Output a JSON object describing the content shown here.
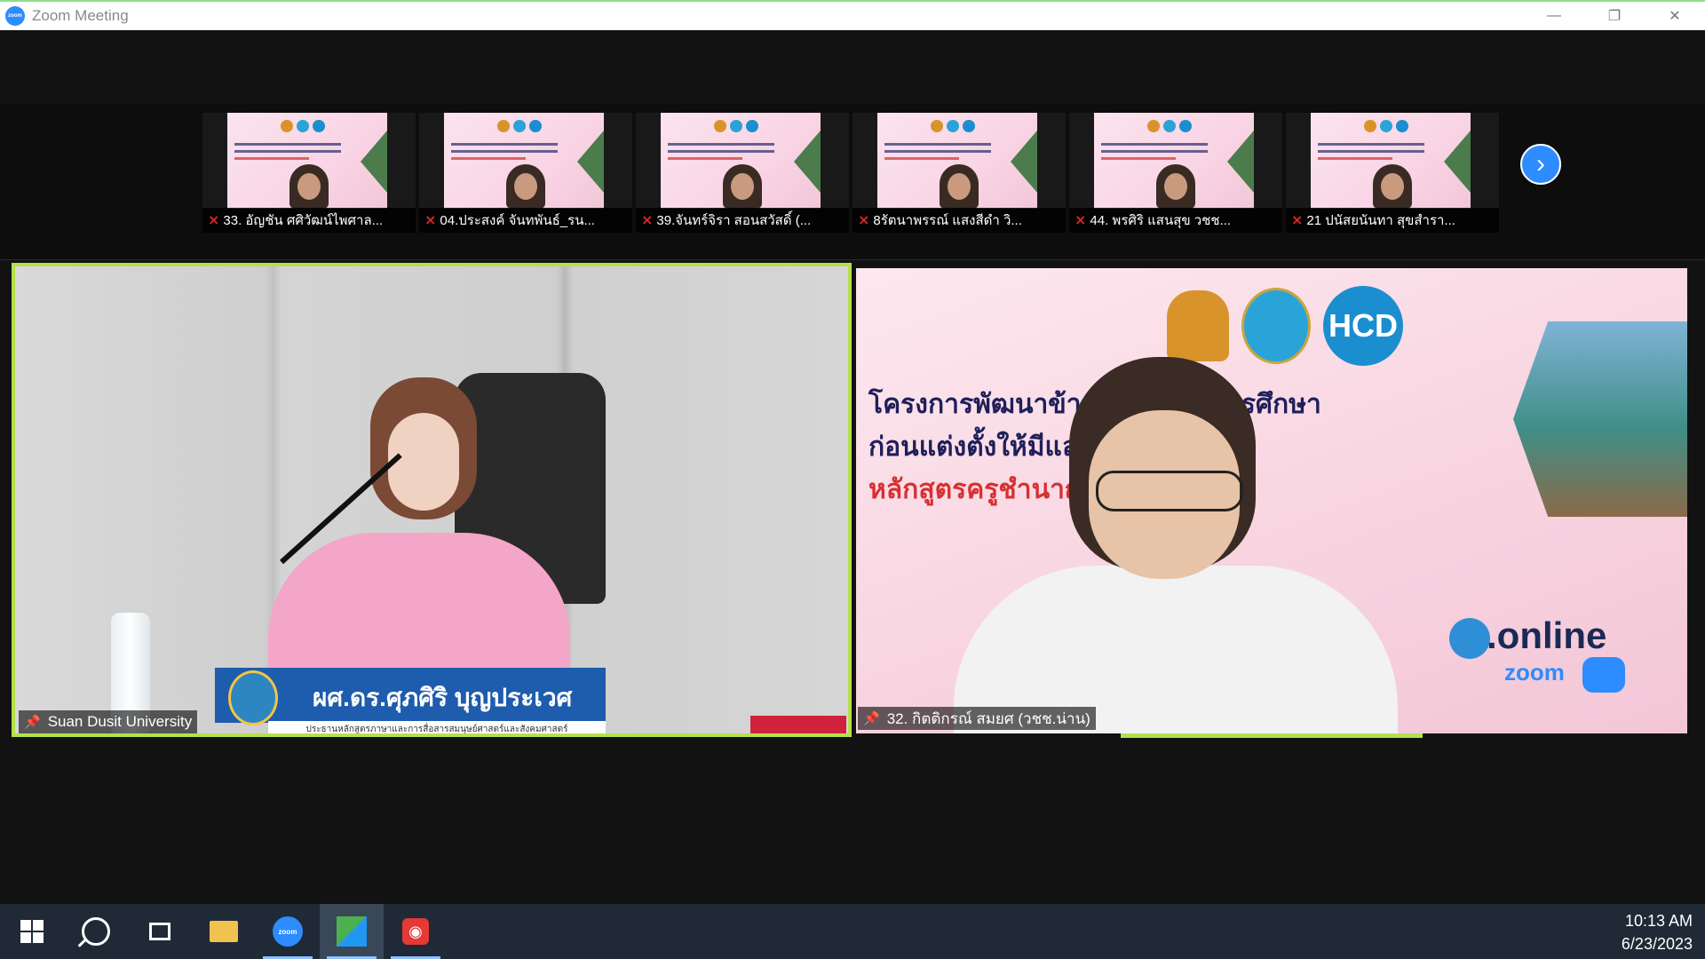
{
  "window": {
    "title": "Zoom Meeting",
    "minimize": "—",
    "maximize": "❐",
    "close": "✕"
  },
  "thumbnails": [
    {
      "name": "33. อัญชัน ศศิวัฒน์ไพศาล..."
    },
    {
      "name": "04.ประสงค์ จันทพันธ์_รน..."
    },
    {
      "name": "39.จันทร์จิรา สอนสวัสดิ์ (..."
    },
    {
      "name": "8รัตนาพรรณ์ แสงสีดำ วิ..."
    },
    {
      "name": "44. พรศิริ แสนสุข วชช..."
    },
    {
      "name": "21 ปนัสยนันทา สุขสำรา..."
    }
  ],
  "next_icon": "›",
  "left_tile": {
    "participant": "Suan Dusit University",
    "lower_third_title": "ผศ.ดร.ศุภศิริ บุญประเวศ",
    "lower_third_subtitle": "ประธานหลักสูตรภาษาและการสื่อสารสมนุษย์ศาสตร์และสังคมศาสตร์"
  },
  "right_tile": {
    "participant": "32. กิตติกรณ์ สมยศ (วชช.น่าน)",
    "slide_line1": "โครงการพัฒนาข้าร                    ลากรทางการศึกษา",
    "slide_line2": "ก่อนแต่งตั้งให้มีแล                   นะ",
    "slide_line3": "หลักสูตรครูชำนาญ                   130",
    "hcd_logo": "HCD",
    "online_text": ".online",
    "zoom_text": "zoom"
  },
  "taskbar": {
    "zoom_label": "zoom",
    "time": "10:13 AM",
    "date": "6/23/2023"
  },
  "icons": [
    "windows-start-icon",
    "search-icon",
    "task-view-icon",
    "file-explorer-icon",
    "zoom-icon",
    "app-icon",
    "red-app-icon",
    "mic-muted-icon",
    "pin-icon",
    "chevron-right-icon"
  ]
}
